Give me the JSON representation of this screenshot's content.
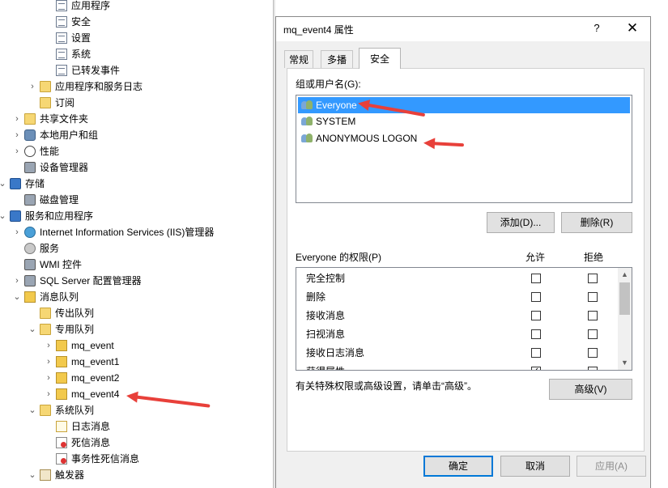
{
  "tree": {
    "items": [
      {
        "label": "应用程序",
        "level": 4,
        "expander": "",
        "icon": "event-log-icon"
      },
      {
        "label": "安全",
        "level": 4,
        "expander": "",
        "icon": "event-log-icon"
      },
      {
        "label": "设置",
        "level": 4,
        "expander": "",
        "icon": "event-log-icon"
      },
      {
        "label": "系统",
        "level": 4,
        "expander": "",
        "icon": "event-log-icon"
      },
      {
        "label": "已转发事件",
        "level": 4,
        "expander": "",
        "icon": "event-log-icon"
      },
      {
        "label": "应用程序和服务日志",
        "level": 3,
        "expander": "›",
        "icon": "folder-icon"
      },
      {
        "label": "订阅",
        "level": 3,
        "expander": "",
        "icon": "subscription-icon"
      },
      {
        "label": "共享文件夹",
        "level": 2,
        "expander": "›",
        "icon": "shared-folder-icon"
      },
      {
        "label": "本地用户和组",
        "level": 2,
        "expander": "›",
        "icon": "users-group-icon"
      },
      {
        "label": "性能",
        "level": 2,
        "expander": "›",
        "icon": "performance-icon"
      },
      {
        "label": "设备管理器",
        "level": 2,
        "expander": "",
        "icon": "device-manager-icon"
      },
      {
        "label": "存储",
        "level": 1,
        "expander": "⌄",
        "icon": "storage-icon"
      },
      {
        "label": "磁盘管理",
        "level": 2,
        "expander": "",
        "icon": "disk-management-icon"
      },
      {
        "label": "服务和应用程序",
        "level": 1,
        "expander": "⌄",
        "icon": "services-apps-icon"
      },
      {
        "label": "Internet Information Services (IIS)管理器",
        "level": 2,
        "expander": "›",
        "icon": "iis-icon"
      },
      {
        "label": "服务",
        "level": 2,
        "expander": "",
        "icon": "services-icon"
      },
      {
        "label": "WMI 控件",
        "level": 2,
        "expander": "",
        "icon": "wmi-icon"
      },
      {
        "label": "SQL Server 配置管理器",
        "level": 2,
        "expander": "›",
        "icon": "sql-server-icon"
      },
      {
        "label": "消息队列",
        "level": 2,
        "expander": "⌄",
        "icon": "message-queue-icon"
      },
      {
        "label": "传出队列",
        "level": 3,
        "expander": "",
        "icon": "folder-icon"
      },
      {
        "label": "专用队列",
        "level": 3,
        "expander": "⌄",
        "icon": "folder-icon"
      },
      {
        "label": "mq_event",
        "level": 4,
        "expander": "›",
        "icon": "queue-icon"
      },
      {
        "label": "mq_event1",
        "level": 4,
        "expander": "›",
        "icon": "queue-icon"
      },
      {
        "label": "mq_event2",
        "level": 4,
        "expander": "›",
        "icon": "queue-icon"
      },
      {
        "label": "mq_event4",
        "level": 4,
        "expander": "›",
        "icon": "queue-icon"
      },
      {
        "label": "系统队列",
        "level": 3,
        "expander": "⌄",
        "icon": "folder-icon"
      },
      {
        "label": "日志消息",
        "level": 4,
        "expander": "",
        "icon": "journal-message-icon"
      },
      {
        "label": "死信消息",
        "level": 4,
        "expander": "",
        "icon": "dead-letter-icon"
      },
      {
        "label": "事务性死信消息",
        "level": 4,
        "expander": "",
        "icon": "dead-letter-icon"
      },
      {
        "label": "触发器",
        "level": 3,
        "expander": "⌄",
        "icon": "trigger-icon"
      }
    ]
  },
  "dialog": {
    "title": "mq_event4 属性",
    "help_label": "?",
    "close_label": "✕",
    "tabs": [
      {
        "label": "常规",
        "active": false
      },
      {
        "label": "多播",
        "active": false
      },
      {
        "label": "安全",
        "active": true
      }
    ],
    "users_label": "组或用户名(G):",
    "users": [
      {
        "name": "Everyone",
        "selected": true
      },
      {
        "name": "SYSTEM",
        "selected": false
      },
      {
        "name": "ANONYMOUS LOGON",
        "selected": false
      }
    ],
    "add_label": "添加(D)...",
    "remove_label": "删除(R)",
    "perm_label": "Everyone 的权限(P)",
    "allow_header": "允许",
    "deny_header": "拒绝",
    "permissions": [
      {
        "name": "完全控制",
        "allow": false,
        "deny": false
      },
      {
        "name": "删除",
        "allow": false,
        "deny": false
      },
      {
        "name": "接收消息",
        "allow": false,
        "deny": false
      },
      {
        "name": "扫视消息",
        "allow": false,
        "deny": false
      },
      {
        "name": "接收日志消息",
        "allow": false,
        "deny": false
      },
      {
        "name": "获得属性",
        "allow": true,
        "deny": false
      }
    ],
    "advanced_hint": "有关特殊权限或高级设置，请单击“高级”。",
    "advanced_label": "高级(V)",
    "ok_label": "确定",
    "cancel_label": "取消",
    "apply_label": "应用(A)"
  }
}
